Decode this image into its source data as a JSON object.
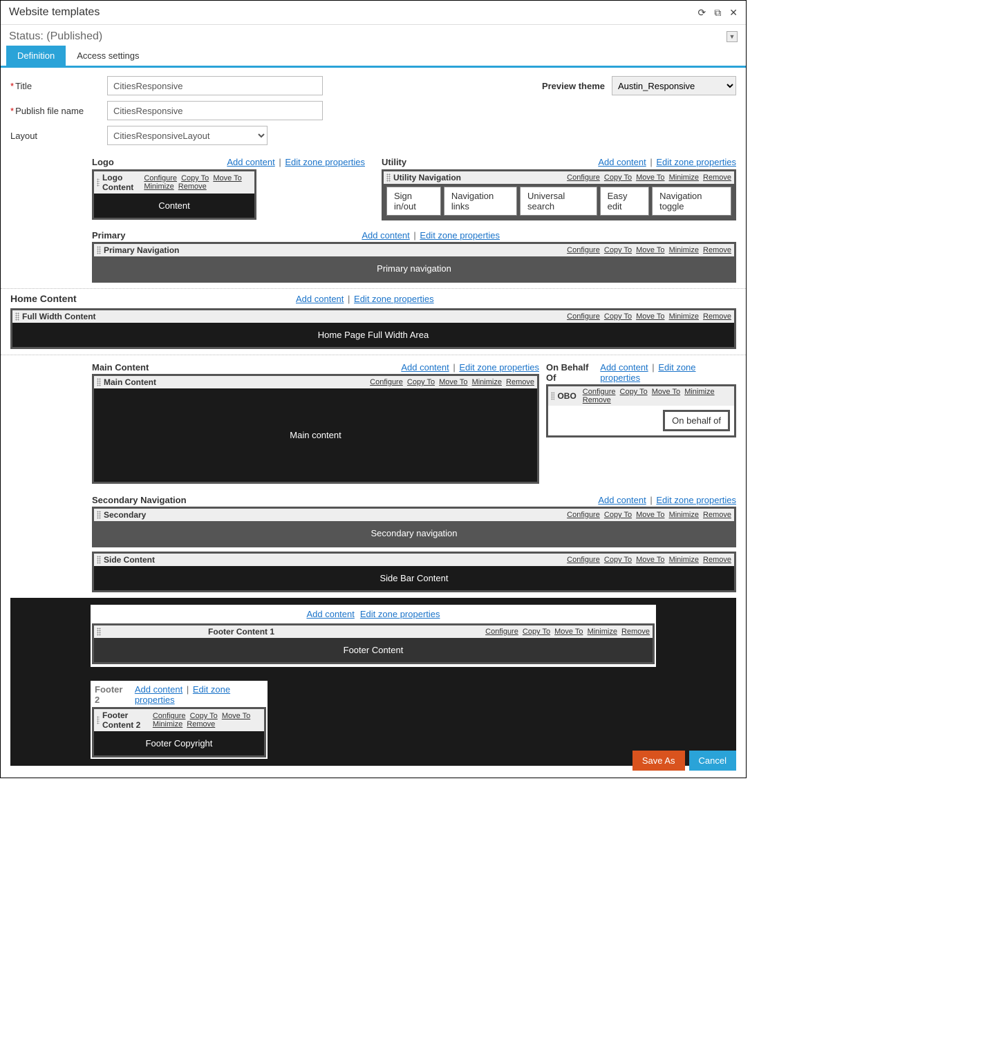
{
  "window": {
    "title": "Website templates"
  },
  "status": {
    "label": "Status:",
    "value": "(Published)"
  },
  "tabs": {
    "definition": "Definition",
    "access": "Access settings"
  },
  "form": {
    "title_label": "Title",
    "title_value": "CitiesResponsive",
    "pubfile_label": "Publish file name",
    "pubfile_value": "CitiesResponsive",
    "layout_label": "Layout",
    "layout_value": "CitiesResponsiveLayout",
    "preview_label": "Preview theme",
    "preview_value": "Austin_Responsive"
  },
  "links": {
    "add": "Add content",
    "edit": "Edit zone properties"
  },
  "acts": {
    "cfg": "Configure",
    "cpy": "Copy To",
    "mov": "Move To",
    "min": "Minimize",
    "rmv": "Remove"
  },
  "zones": {
    "logo": {
      "title": "Logo",
      "widget": "Logo Content",
      "body": "Content"
    },
    "utility": {
      "title": "Utility",
      "widget": "Utility Navigation",
      "items": [
        "Sign in/out",
        "Navigation links",
        "Universal search",
        "Easy edit",
        "Navigation toggle"
      ]
    },
    "primary": {
      "title": "Primary",
      "widget": "Primary Navigation",
      "body": "Primary navigation"
    },
    "home": {
      "title": "Home Content",
      "widget": "Full Width Content",
      "body": "Home Page Full Width Area"
    },
    "main": {
      "title": "Main Content",
      "widget": "Main Content",
      "body": "Main content"
    },
    "obo": {
      "title": "On Behalf Of",
      "widget": "OBO",
      "item": "On behalf of"
    },
    "secnav": {
      "title": "Secondary Navigation",
      "widget": "Secondary",
      "body": "Secondary navigation",
      "widget2": "Side Content",
      "body2": "Side Bar Content"
    },
    "footer1": {
      "widget": "Footer Content 1",
      "body": "Footer Content"
    },
    "footer2": {
      "title": "Footer 2",
      "widget": "Footer Content 2",
      "body": "Footer Copyright"
    }
  },
  "buttons": {
    "save": "Save As",
    "cancel": "Cancel"
  }
}
